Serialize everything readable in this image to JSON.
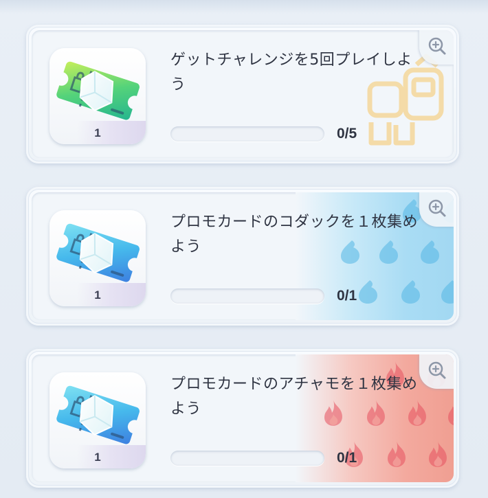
{
  "missions": [
    {
      "title": "ゲットチャレンジを5回プレイしよう",
      "reward_count": "1",
      "progress_text": "0/5",
      "progress_fraction": 0,
      "ticket_variant": "green-ticket-icon",
      "background_deco": "gold-pattern"
    },
    {
      "title": "プロモカードのコダックを１枚集めよう",
      "reward_count": "1",
      "progress_text": "0/1",
      "progress_fraction": 0,
      "ticket_variant": "blue-ticket-icon",
      "background_deco": "water-drops"
    },
    {
      "title": "プロモカードのアチャモを１枚集めよう",
      "reward_count": "1",
      "progress_text": "0/1",
      "progress_fraction": 0,
      "ticket_variant": "blue-ticket-icon",
      "background_deco": "fire-flames"
    }
  ],
  "colors": {
    "water_accent": "#a2d8f2",
    "fire_accent": "#f09f92",
    "gold_accent": "#f5d79a",
    "text": "#2f3442"
  }
}
